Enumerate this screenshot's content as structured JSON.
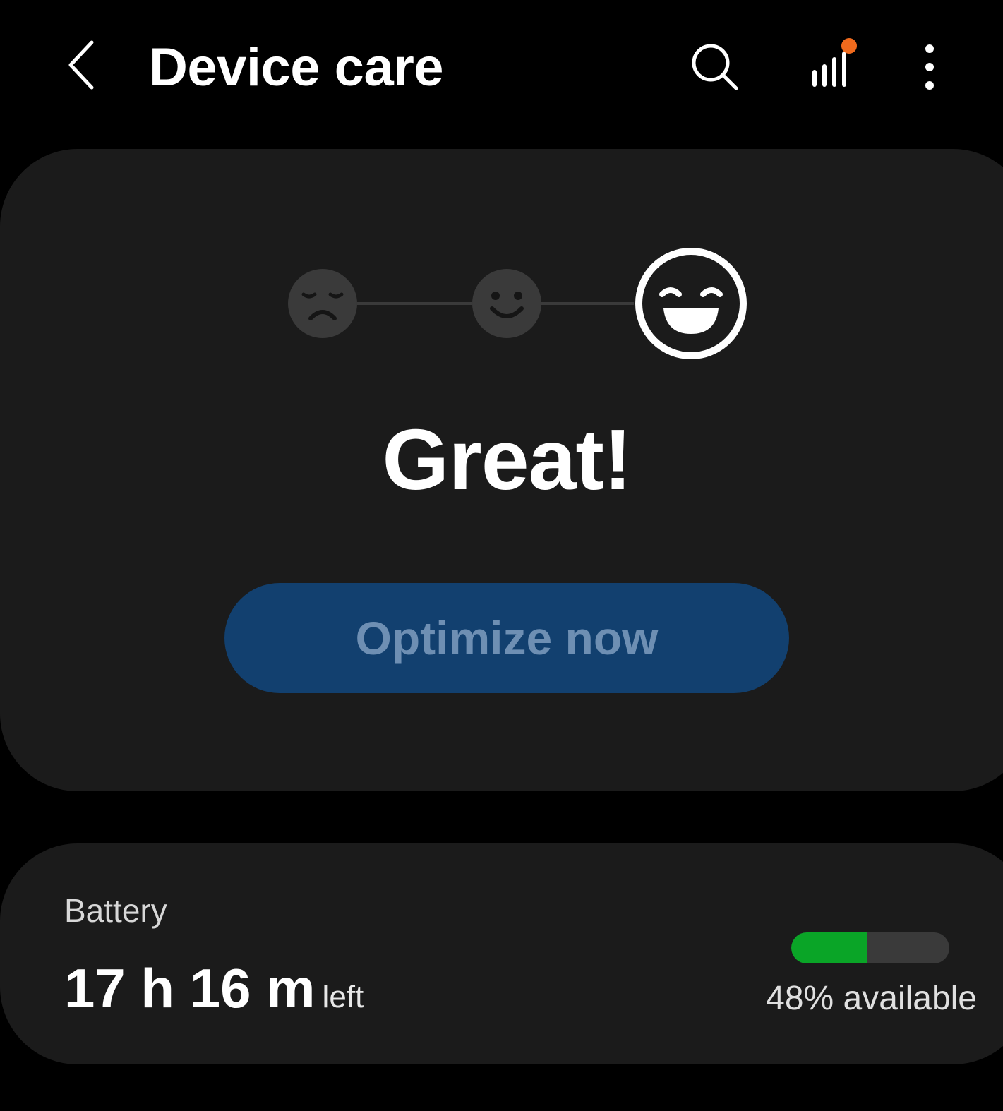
{
  "header": {
    "back_icon": "chevron-left-icon",
    "title": "Device care",
    "search_icon": "search-icon",
    "signal_icon": "signal-bars-icon",
    "more_icon": "more-vertical-icon",
    "notification_dot_color": "#f06a1d"
  },
  "status": {
    "faces": [
      "sad-face-icon",
      "smile-face-icon",
      "laughing-face-icon"
    ],
    "selected_face": "laughing-face-icon",
    "text": "Great!",
    "optimize_label": "Optimize now",
    "button_color": "#12406f"
  },
  "battery": {
    "label": "Battery",
    "time_value": "17 h 16 m",
    "time_suffix": "left",
    "level_fraction": 0.48,
    "fill_color": "#0aa527",
    "available_text": "48% available"
  }
}
